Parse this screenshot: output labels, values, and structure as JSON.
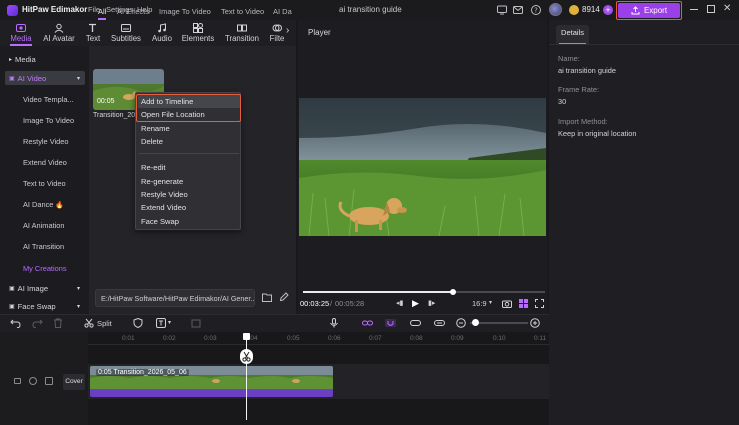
{
  "app": {
    "name": "HitPaw Edimakor",
    "menus": [
      "File",
      "Settings",
      "Help"
    ],
    "document_title": "ai transition guide",
    "credits": "8914",
    "export_label": "Export"
  },
  "tool_tabs": [
    {
      "label": "Media",
      "icon": "media-icon",
      "active": true
    },
    {
      "label": "AI Avatar",
      "icon": "ai-avatar-icon"
    },
    {
      "label": "Text",
      "icon": "text-icon"
    },
    {
      "label": "Subtitles",
      "icon": "subtitles-icon"
    },
    {
      "label": "Audio",
      "icon": "audio-icon"
    },
    {
      "label": "Elements",
      "icon": "elements-icon"
    },
    {
      "label": "Transition",
      "icon": "transition-icon"
    },
    {
      "label": "Filte",
      "icon": "filter-icon"
    }
  ],
  "sidebar": {
    "heads": [
      {
        "label": "Media",
        "active": false
      },
      {
        "label": "AI Video",
        "active": true
      },
      {
        "label": "AI Image",
        "active": false
      },
      {
        "label": "Face Swap",
        "active": false
      }
    ],
    "items": [
      "Video Templa...",
      "Image To Video",
      "Restyle Video",
      "Extend Video",
      "Text to Video",
      "AI Dance",
      "AI Animation",
      "AI Transition",
      "My Creations"
    ],
    "selected_item": "My Creations"
  },
  "media": {
    "filter_tabs": [
      "All",
      "AI Effects",
      "Image To Video",
      "Text to Video",
      "AI Da"
    ],
    "active_filter": "All",
    "thumb": {
      "duration": "00:05",
      "name": "Transition_20..."
    },
    "path": "E:/HitPaw Software/HitPaw Edimakor/AI Gener..."
  },
  "context_menu": {
    "items": [
      "Add to Timeline",
      "Open File Location",
      "Rename",
      "Delete",
      "Re-edit",
      "Re-generate",
      "Restyle Video",
      "Extend Video",
      "Face Swap"
    ]
  },
  "player": {
    "title": "Player",
    "current_time": "00:03:25",
    "separator": "/",
    "total_time": "00:05:28",
    "aspect": "16:9",
    "progress": 0.62
  },
  "details": {
    "tab": "Details",
    "fields": [
      {
        "label": "Name:",
        "value": "ai transition guide"
      },
      {
        "label": "Frame Rate:",
        "value": "30"
      },
      {
        "label": "Import Method:",
        "value": "Keep in original location"
      }
    ]
  },
  "timeline": {
    "split_label": "Split",
    "ruler": [
      "0:01",
      "0:02",
      "0:03",
      "0:04",
      "0:05",
      "0:06",
      "0:07",
      "0:08",
      "0:09",
      "0:10",
      "0:11"
    ],
    "clip_label": "0:05 Transition_2026_05_06",
    "cover_label": "Cover"
  },
  "colors": {
    "accent": "#b96cff",
    "export_bg": "#9b3fe8",
    "highlight_box": "#e4603d"
  }
}
